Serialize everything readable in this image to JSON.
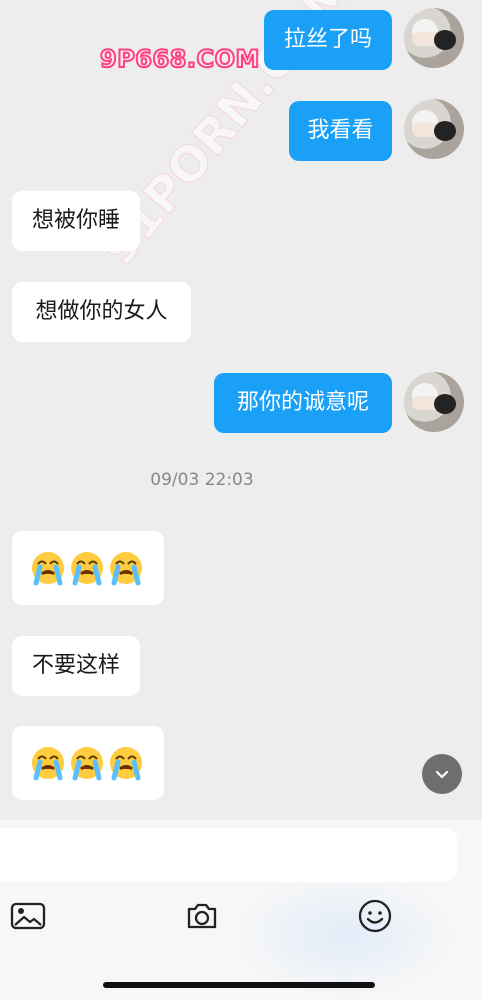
{
  "watermark": "9P668.COM",
  "diagonal_watermark": "91PORN.COM",
  "messages": [
    {
      "side": "out",
      "text": "拉丝了吗"
    },
    {
      "side": "out",
      "text": "我看看"
    },
    {
      "side": "in",
      "text": "想被你睡"
    },
    {
      "side": "in",
      "text": "想做你的女人"
    },
    {
      "side": "out",
      "text": "那你的诚意呢"
    },
    {
      "type": "timestamp",
      "text": "09/03 22:03"
    },
    {
      "side": "in",
      "type": "emoji",
      "emoji": "loudly-crying-face",
      "count": 3
    },
    {
      "side": "in",
      "text": "不要这样"
    },
    {
      "side": "in",
      "type": "emoji",
      "emoji": "loudly-crying-face",
      "count": 3
    }
  ],
  "controls": {
    "scroll_down_icon": "chevron-down-icon",
    "message_input_placeholder": "",
    "toolbar": [
      "image-icon",
      "camera-icon",
      "emoji-icon"
    ]
  },
  "colors": {
    "outgoing_bubble": "#1aa1f7",
    "incoming_bubble": "#ffffff",
    "chat_background": "#ededed"
  }
}
